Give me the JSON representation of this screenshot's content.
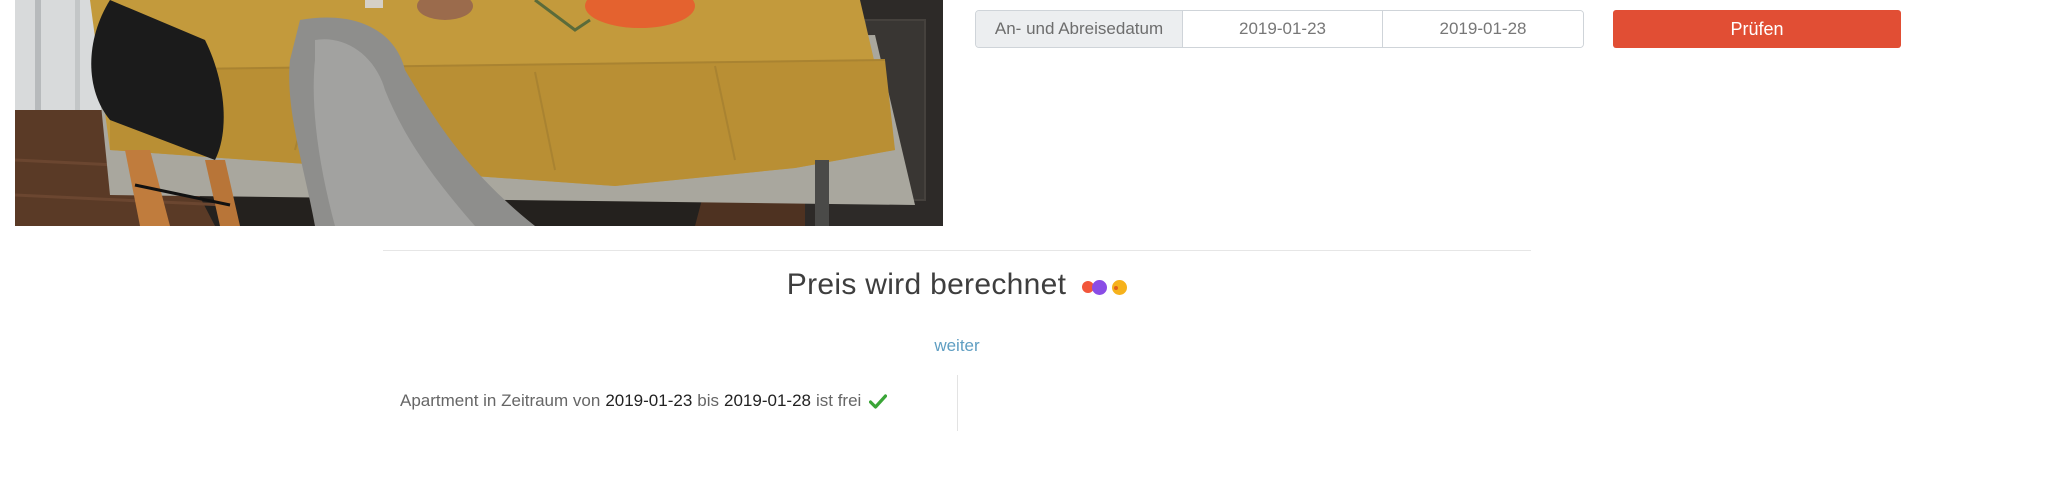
{
  "booking_form": {
    "date_label": "An- und Abreisedatum",
    "arrival_date": "2019-01-23",
    "departure_date": "2019-01-28",
    "check_button_label": "Prüfen",
    "accent_color": "#e14e34"
  },
  "price": {
    "heading": "Preis wird berechnet",
    "loader_colors": [
      "#f2563b",
      "#8a4de6",
      "#f6b21c"
    ]
  },
  "continue_link": "weiter",
  "availability": {
    "prefix": "Apartment in Zeitraum von",
    "from_date": "2019-01-23",
    "connector": "bis",
    "to_date": "2019-01-28",
    "status": "ist frei",
    "status_icon": "checkmark-icon",
    "status_color": "#3aa537"
  },
  "photo": {
    "icon": "dining-table-photo"
  }
}
